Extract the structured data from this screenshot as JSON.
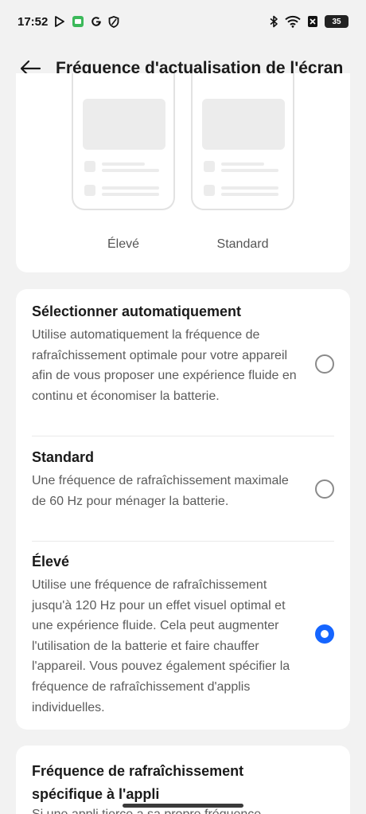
{
  "status_bar": {
    "time": "17:52",
    "left_icons": [
      "play-store-icon",
      "app-icon",
      "google-icon",
      "shield-icon"
    ],
    "right_icons": [
      "bluetooth-icon",
      "wifi-icon",
      "sim-icon"
    ],
    "battery": "35"
  },
  "header": {
    "back_icon": "arrow-left-icon",
    "title": "Fréquence d'actualisation de l'écran"
  },
  "preview": {
    "high_label": "Élevé",
    "standard_label": "Standard"
  },
  "options": [
    {
      "title": "Sélectionner automatiquement",
      "description": "Utilise automatiquement la fréquence de rafraîchissement optimale pour votre appareil afin de vous proposer une expérience fluide en continu et économiser la batterie.",
      "selected": false
    },
    {
      "title": "Standard",
      "description": "Une fréquence de rafraîchissement maximale de 60 Hz pour ménager la batterie.",
      "selected": false
    },
    {
      "title": "Élevé",
      "description": "Utilise une fréquence de rafraîchissement jusqu'à 120 Hz pour un effet visuel optimal et une expérience fluide. Cela peut augmenter l'utilisation de la batterie et faire chauffer l'appareil. Vous pouvez également spécifier la fréquence de rafraîchissement d'applis individuelles.",
      "selected": true
    }
  ],
  "app_specific": {
    "title": "Fréquence de rafraîchissement spécifique à l'appli",
    "description": "Si une appli tierce a sa propre fréquence"
  },
  "colors": {
    "accent": "#1565ff",
    "background": "#f2f2f2",
    "card": "#ffffff"
  }
}
